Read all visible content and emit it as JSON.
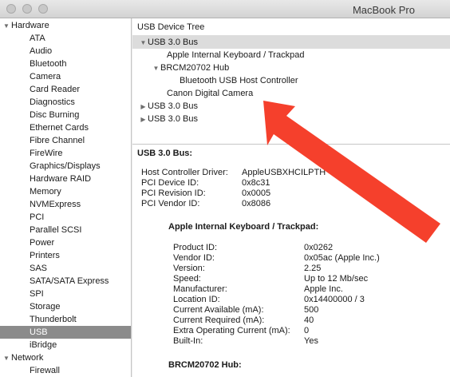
{
  "window": {
    "title": "MacBook Pro"
  },
  "sidebar": {
    "groups": [
      {
        "label": "Hardware",
        "expanded": true,
        "items": [
          "ATA",
          "Audio",
          "Bluetooth",
          "Camera",
          "Card Reader",
          "Diagnostics",
          "Disc Burning",
          "Ethernet Cards",
          "Fibre Channel",
          "FireWire",
          "Graphics/Displays",
          "Hardware RAID",
          "Memory",
          "NVMExpress",
          "PCI",
          "Parallel SCSI",
          "Power",
          "Printers",
          "SAS",
          "SATA/SATA Express",
          "SPI",
          "Storage",
          "Thunderbolt",
          "USB",
          "iBridge"
        ]
      },
      {
        "label": "Network",
        "expanded": true,
        "items": [
          "Firewall"
        ]
      }
    ],
    "selected": "USB"
  },
  "tree": {
    "header": "USB Device Tree",
    "rows": [
      {
        "label": "USB 3.0 Bus",
        "level": 0,
        "disclosure": "expanded",
        "selected": true
      },
      {
        "label": "Apple Internal Keyboard / Trackpad",
        "level": 1,
        "disclosure": "none"
      },
      {
        "label": "BRCM20702 Hub",
        "level": 1,
        "disclosure": "expanded"
      },
      {
        "label": "Bluetooth USB Host Controller",
        "level": 2,
        "disclosure": "none"
      },
      {
        "label": "Canon Digital Camera",
        "level": 1,
        "disclosure": "none"
      },
      {
        "label": "USB 3.0 Bus",
        "level": 0,
        "disclosure": "collapsed"
      },
      {
        "label": "USB 3.0 Bus",
        "level": 0,
        "disclosure": "collapsed"
      }
    ]
  },
  "details": {
    "title": "USB 3.0 Bus:",
    "bus_props": [
      {
        "key": "Host Controller Driver:",
        "value": "AppleUSBXHCILPTH"
      },
      {
        "key": "PCI Device ID:",
        "value": "0x8c31"
      },
      {
        "key": "PCI Revision ID:",
        "value": "0x0005"
      },
      {
        "key": "PCI Vendor ID:",
        "value": "0x8086"
      }
    ],
    "device_title": "Apple Internal Keyboard / Trackpad:",
    "device_props": [
      {
        "key": "Product ID:",
        "value": "0x0262"
      },
      {
        "key": "Vendor ID:",
        "value": "0x05ac  (Apple Inc.)"
      },
      {
        "key": "Version:",
        "value": "2.25"
      },
      {
        "key": "Speed:",
        "value": "Up to 12 Mb/sec"
      },
      {
        "key": "Manufacturer:",
        "value": "Apple Inc."
      },
      {
        "key": "Location ID:",
        "value": "0x14400000 / 3"
      },
      {
        "key": "Current Available (mA):",
        "value": "500"
      },
      {
        "key": "Current Required (mA):",
        "value": "40"
      },
      {
        "key": "Extra Operating Current (mA):",
        "value": "0"
      },
      {
        "key": "Built-In:",
        "value": "Yes"
      }
    ],
    "next_title": "BRCM20702 Hub:"
  },
  "colors": {
    "annotation_arrow": "#f5402c",
    "selection": "#8b8b8b"
  },
  "icons": {
    "expanded": "disclosure-down-icon",
    "collapsed": "disclosure-right-icon"
  }
}
